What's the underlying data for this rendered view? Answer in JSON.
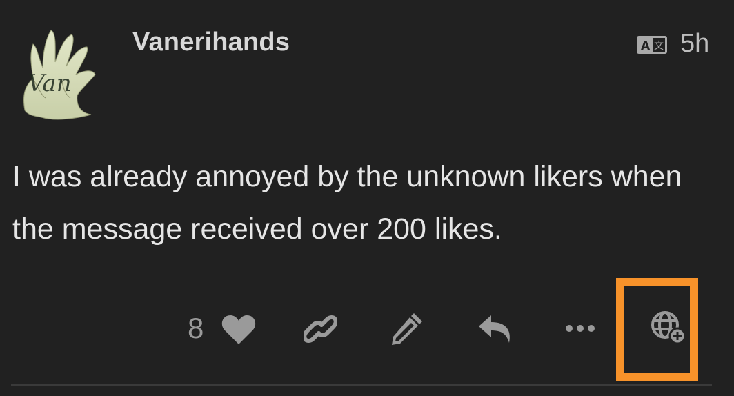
{
  "post": {
    "username": "Vanerihands",
    "avatar": {
      "icon": "hand-logo-avatar",
      "lettering": "Van"
    },
    "translate_icon": "translate-icon",
    "translate_badge_text": "A 文",
    "timestamp": "5h",
    "body": "I was already annoyed by the unknown likers when the message received over 200 likes."
  },
  "actions": {
    "like_count": "8",
    "like_icon": "heart-icon",
    "link_icon": "link-icon",
    "edit_icon": "pencil-icon",
    "reply_icon": "reply-icon",
    "more_icon": "ellipsis-icon",
    "globe_icon": "globe-plus-icon"
  },
  "colors": {
    "background": "#212121",
    "text_primary": "#e6e6e6",
    "icon_gray": "#9a9a9a",
    "highlight": "#f7922a"
  }
}
